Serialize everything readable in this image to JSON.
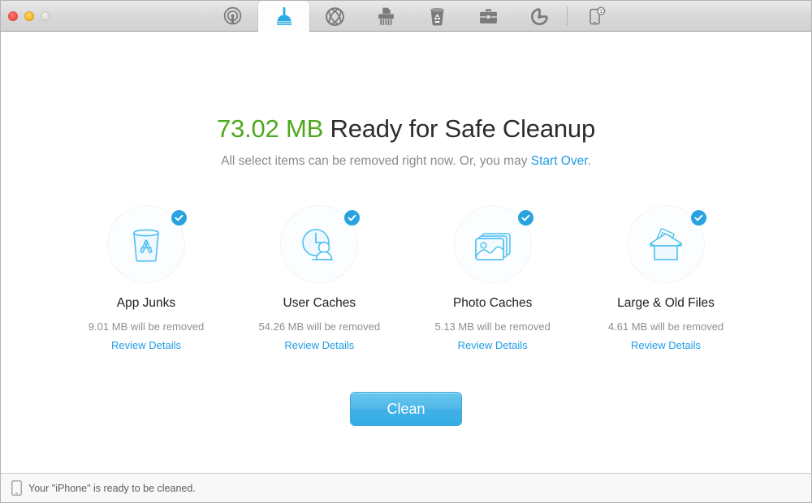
{
  "window": {
    "traffic_lights": [
      "close",
      "minimize",
      "zoom"
    ]
  },
  "toolbar": {
    "tabs": [
      {
        "name": "status",
        "icon": "radar-icon",
        "active": false,
        "badge": null
      },
      {
        "name": "cleanup",
        "icon": "plunger-icon",
        "active": true,
        "badge": null
      },
      {
        "name": "privacy",
        "icon": "globe-icon",
        "active": false,
        "badge": null
      },
      {
        "name": "shredder",
        "icon": "shredder-icon",
        "active": false,
        "badge": null
      },
      {
        "name": "trash",
        "icon": "recycle-bin-icon",
        "active": false,
        "badge": null
      },
      {
        "name": "toolkit",
        "icon": "toolbox-icon",
        "active": false,
        "badge": null
      },
      {
        "name": "refresh",
        "icon": "reload-icon",
        "active": false,
        "badge": null
      },
      {
        "name": "device",
        "icon": "phone-icon",
        "active": false,
        "badge": "1"
      }
    ]
  },
  "main": {
    "headline_size": "73.02 MB",
    "headline_rest": " Ready for Safe Cleanup",
    "subline_prefix": "All select items can be removed right now. Or, you may ",
    "subline_link": "Start Over",
    "subline_suffix": ".",
    "clean_button_label": "Clean",
    "review_link_label": "Review Details",
    "cards": [
      {
        "title": "App Junks",
        "size_text": "9.01 MB will be removed",
        "link": "Review Details",
        "icon": "app-junk-bin-icon",
        "checked": true
      },
      {
        "title": "User Caches",
        "size_text": "54.26 MB will be removed",
        "link": "Review Details",
        "icon": "user-clock-icon",
        "checked": true
      },
      {
        "title": "Photo Caches",
        "size_text": "5.13 MB will be removed",
        "link": "Review Details",
        "icon": "photo-stack-icon",
        "checked": true
      },
      {
        "title": "Large & Old Files",
        "size_text": "4.61 MB will be removed",
        "link": "Review Details",
        "icon": "open-box-icon",
        "checked": true
      }
    ]
  },
  "statusbar": {
    "text": "Your \"iPhone\" is ready to be cleaned.",
    "icon": "phone-icon"
  },
  "colors": {
    "accent_blue": "#1f9ce4",
    "badge_blue": "#29a3e0",
    "size_green": "#4fa81d",
    "icon_outline": "#4fc0f0",
    "text_dark": "#2d2d2d",
    "text_muted": "#8f8f8f"
  }
}
